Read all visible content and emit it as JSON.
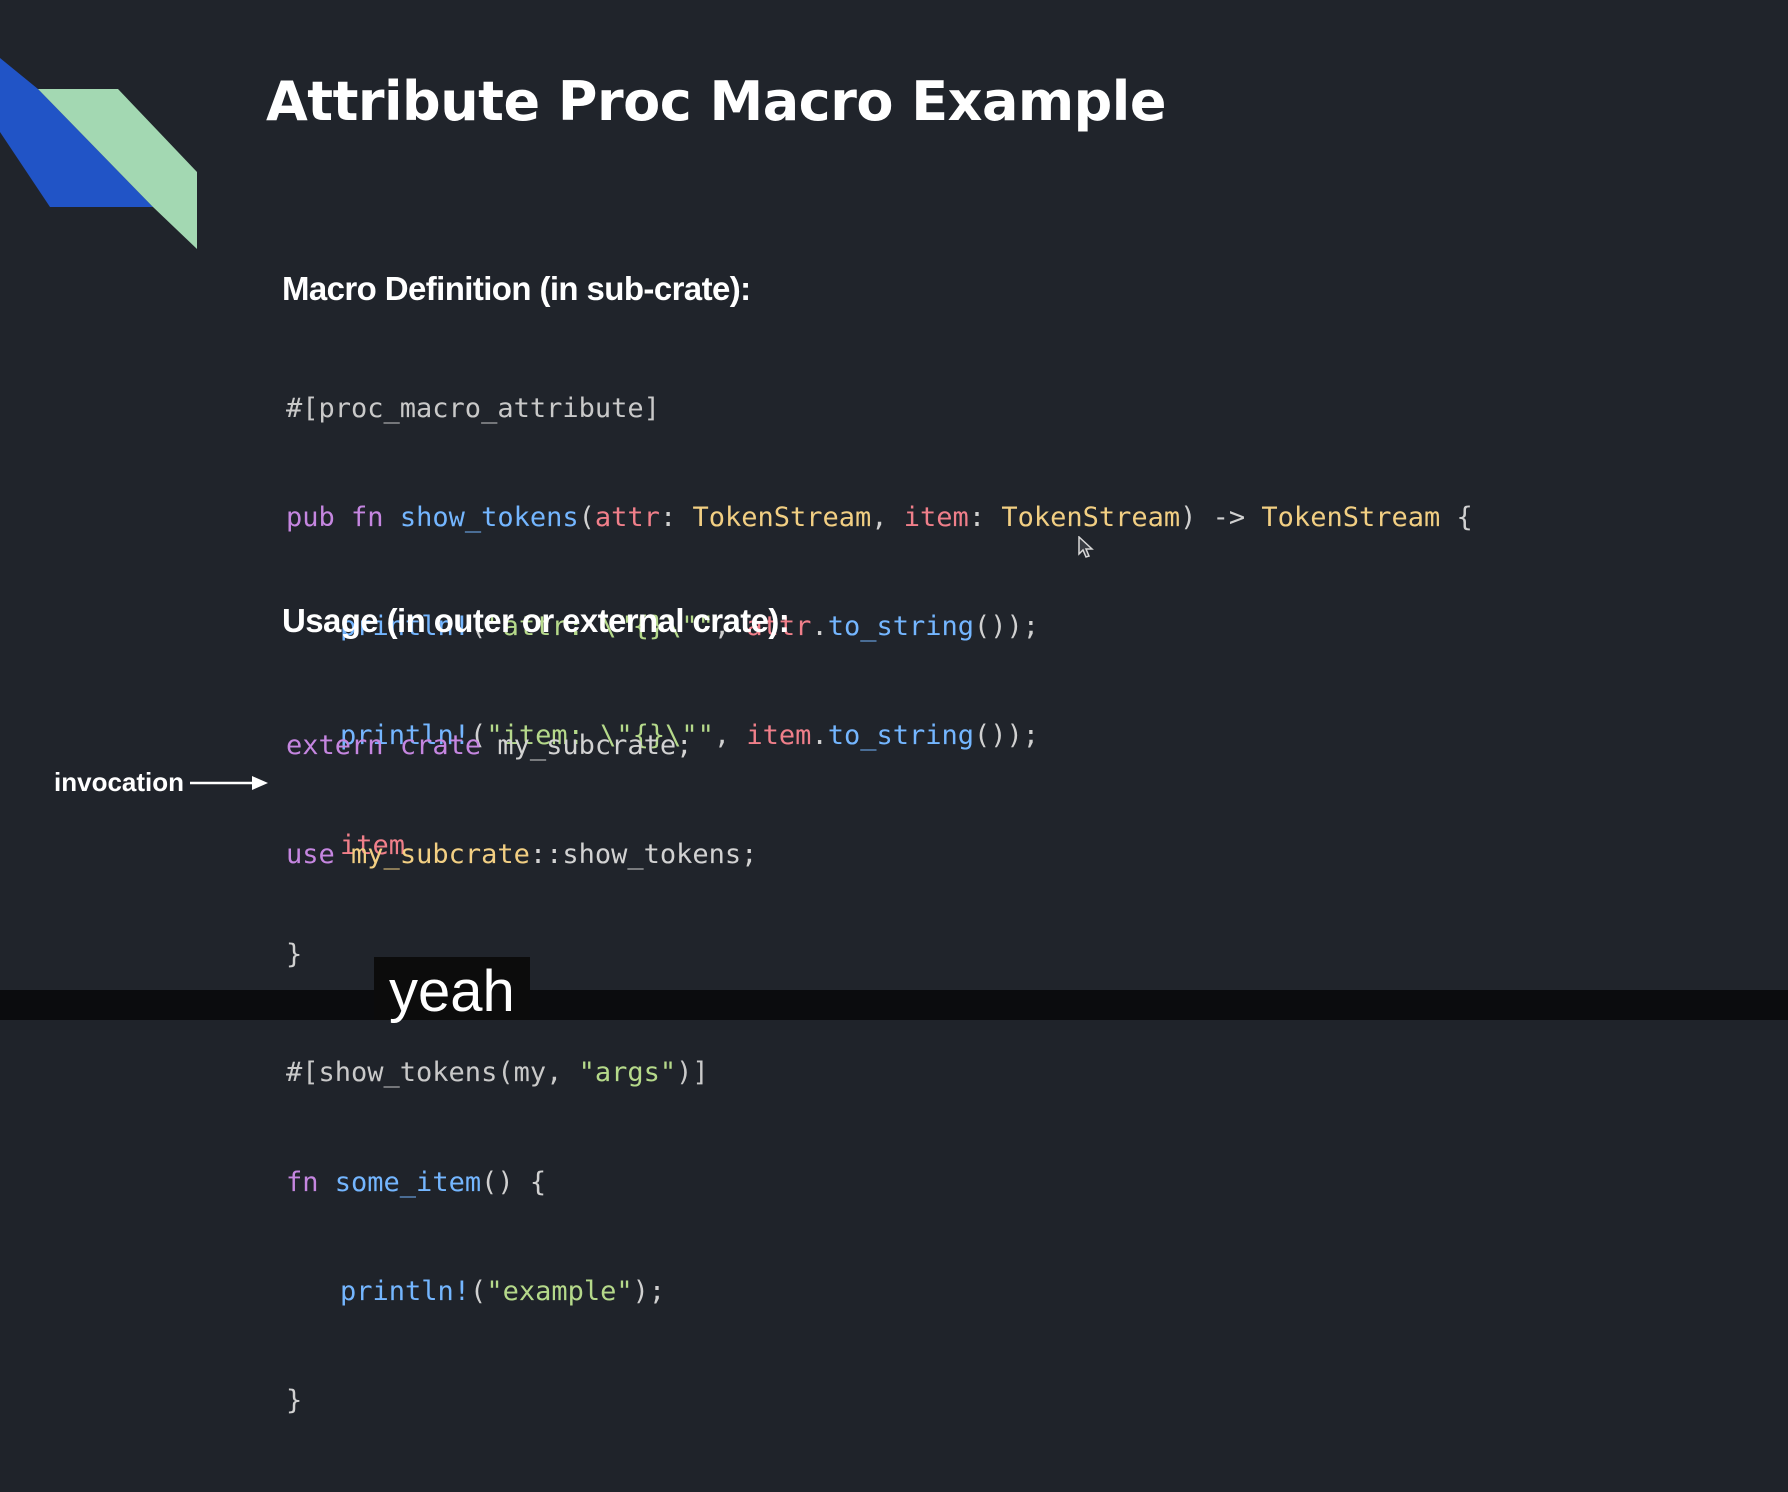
{
  "slide": {
    "title": "Attribute Proc Macro Example",
    "accent_colors": {
      "blue": "#2154c6",
      "mint": "#a3d8b2"
    },
    "definition_heading": "Macro Definition (in sub-crate):",
    "usage_heading": "Usage (in outer or external crate):",
    "invocation_label": "invocation",
    "definition_code": {
      "l1": {
        "a": "#[proc_macro_attribute]"
      },
      "l2": {
        "a": "pub",
        "b": " ",
        "c": "fn",
        "d": " ",
        "e": "show_tokens",
        "f": "(",
        "g": "attr",
        "h": ": ",
        "i": "TokenStream",
        "j": ", ",
        "k": "item",
        "l": ": ",
        "m": "TokenStream",
        "n": ") -> ",
        "o": "TokenStream",
        "p": " {"
      },
      "l3": {
        "a": "println!",
        "b": "(",
        "c": "\"attr: \\\"{}\\\"\"",
        "d": ", ",
        "e": "attr",
        "f": ".",
        "g": "to_string",
        "h": "());"
      },
      "l4": {
        "a": "println!",
        "b": "(",
        "c": "\"item: \\\"{}\\\"\"",
        "d": ", ",
        "e": "item",
        "f": ".",
        "g": "to_string",
        "h": "());"
      },
      "l5": {
        "a": "item"
      },
      "l6": {
        "a": "}"
      }
    },
    "usage_code": {
      "l1": {
        "a": "extern",
        "b": " ",
        "c": "crate",
        "d": " my_subcrate;"
      },
      "l2": {
        "a": "use",
        "b": " ",
        "c": "my_subcrate",
        "d": "::show_tokens;"
      },
      "l3": {
        "a": "#[show_tokens(my, ",
        "b": "\"args\"",
        "c": ")]"
      },
      "l4": {
        "a": "fn",
        "b": " ",
        "c": "some_item",
        "d": "() {"
      },
      "l5": {
        "a": "println!",
        "b": "(",
        "c": "\"example\"",
        "d": ");"
      },
      "l6": {
        "a": "}"
      }
    }
  },
  "caption": "yeah"
}
